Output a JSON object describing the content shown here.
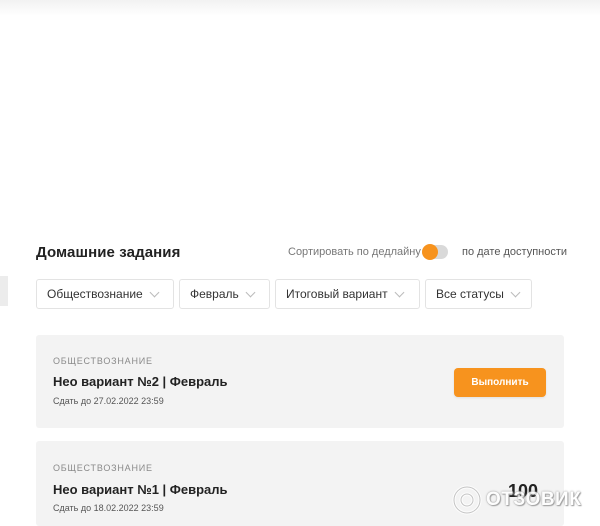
{
  "page": {
    "title": "Домашние задания",
    "sort_label": "Сортировать по дедлайну",
    "availability_label": "по дате доступности",
    "toggle_state": "on"
  },
  "filters": [
    {
      "label": "Обществознание"
    },
    {
      "label": "Февраль"
    },
    {
      "label": "Итоговый вариант"
    },
    {
      "label": "Все статусы"
    }
  ],
  "assignments": [
    {
      "subject": "ОБЩЕСТВОЗНАНИЕ",
      "title": "Нео вариант №2 | Февраль",
      "deadline": "Сдать до 27.02.2022 23:59",
      "action_label": "Выполнить"
    },
    {
      "subject": "ОБЩЕСТВОЗНАНИЕ",
      "title": "Нео вариант №1 | Февраль",
      "deadline": "Сдать до 18.02.2022 23:59",
      "score": "100"
    }
  ],
  "watermark": {
    "text": "ОТЗОВИК"
  },
  "colors": {
    "accent": "#f7931e",
    "card_bg": "#f3f3f3",
    "border": "#e3e3e3"
  },
  "icons": {
    "filter_chevron": "chevron-down-icon",
    "watermark_logo": "otzovik-logo-icon"
  }
}
